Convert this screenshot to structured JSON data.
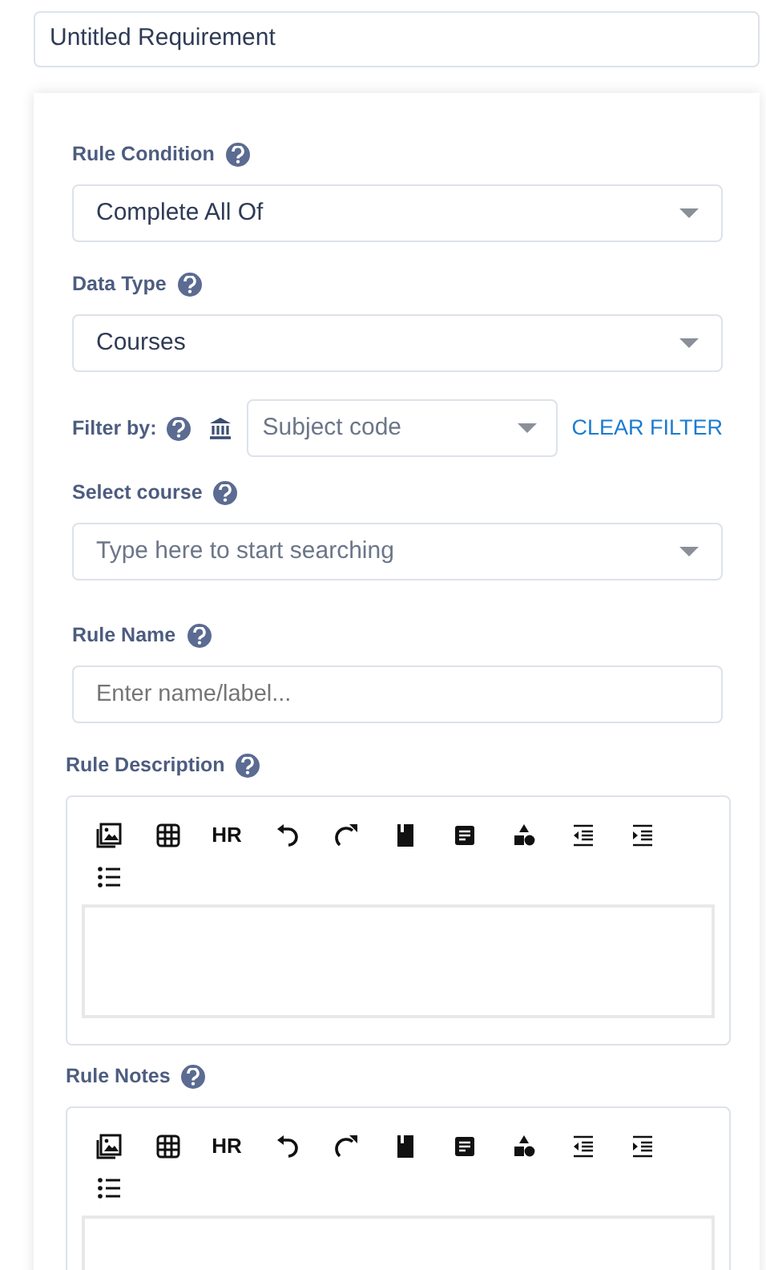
{
  "title_field": {
    "value": "Untitled Requirement"
  },
  "fields": [
    {
      "kind": "select",
      "label": "Rule Condition",
      "value": "Complete All Of"
    },
    {
      "kind": "select",
      "label": "Data Type",
      "value": "Courses"
    },
    {
      "kind": "filter",
      "label": "Filter by:",
      "placeholder": "Subject code",
      "action": "CLEAR FILTER"
    },
    {
      "kind": "search",
      "label": "Select course",
      "placeholder": "Type here to start searching"
    },
    {
      "kind": "input",
      "label": "Rule Name",
      "placeholder": "Enter name/label..."
    },
    {
      "kind": "editor",
      "label": "Rule Description",
      "toolbar": [
        {
          "kind": "image"
        },
        {
          "kind": "table"
        },
        {
          "kind": "text",
          "label": "HR"
        },
        {
          "kind": "undo"
        },
        {
          "kind": "redo"
        },
        {
          "kind": "bookmark"
        },
        {
          "kind": "textblock"
        },
        {
          "kind": "shapes"
        },
        {
          "kind": "outdent"
        },
        {
          "kind": "indent"
        },
        {
          "kind": "list"
        }
      ]
    },
    {
      "kind": "editor",
      "label": "Rule Notes",
      "toolbar": [
        {
          "kind": "image"
        },
        {
          "kind": "table"
        },
        {
          "kind": "text",
          "label": "HR"
        },
        {
          "kind": "undo"
        },
        {
          "kind": "redo"
        },
        {
          "kind": "bookmark"
        },
        {
          "kind": "textblock"
        },
        {
          "kind": "shapes"
        },
        {
          "kind": "outdent"
        },
        {
          "kind": "indent"
        },
        {
          "kind": "list"
        }
      ]
    }
  ]
}
